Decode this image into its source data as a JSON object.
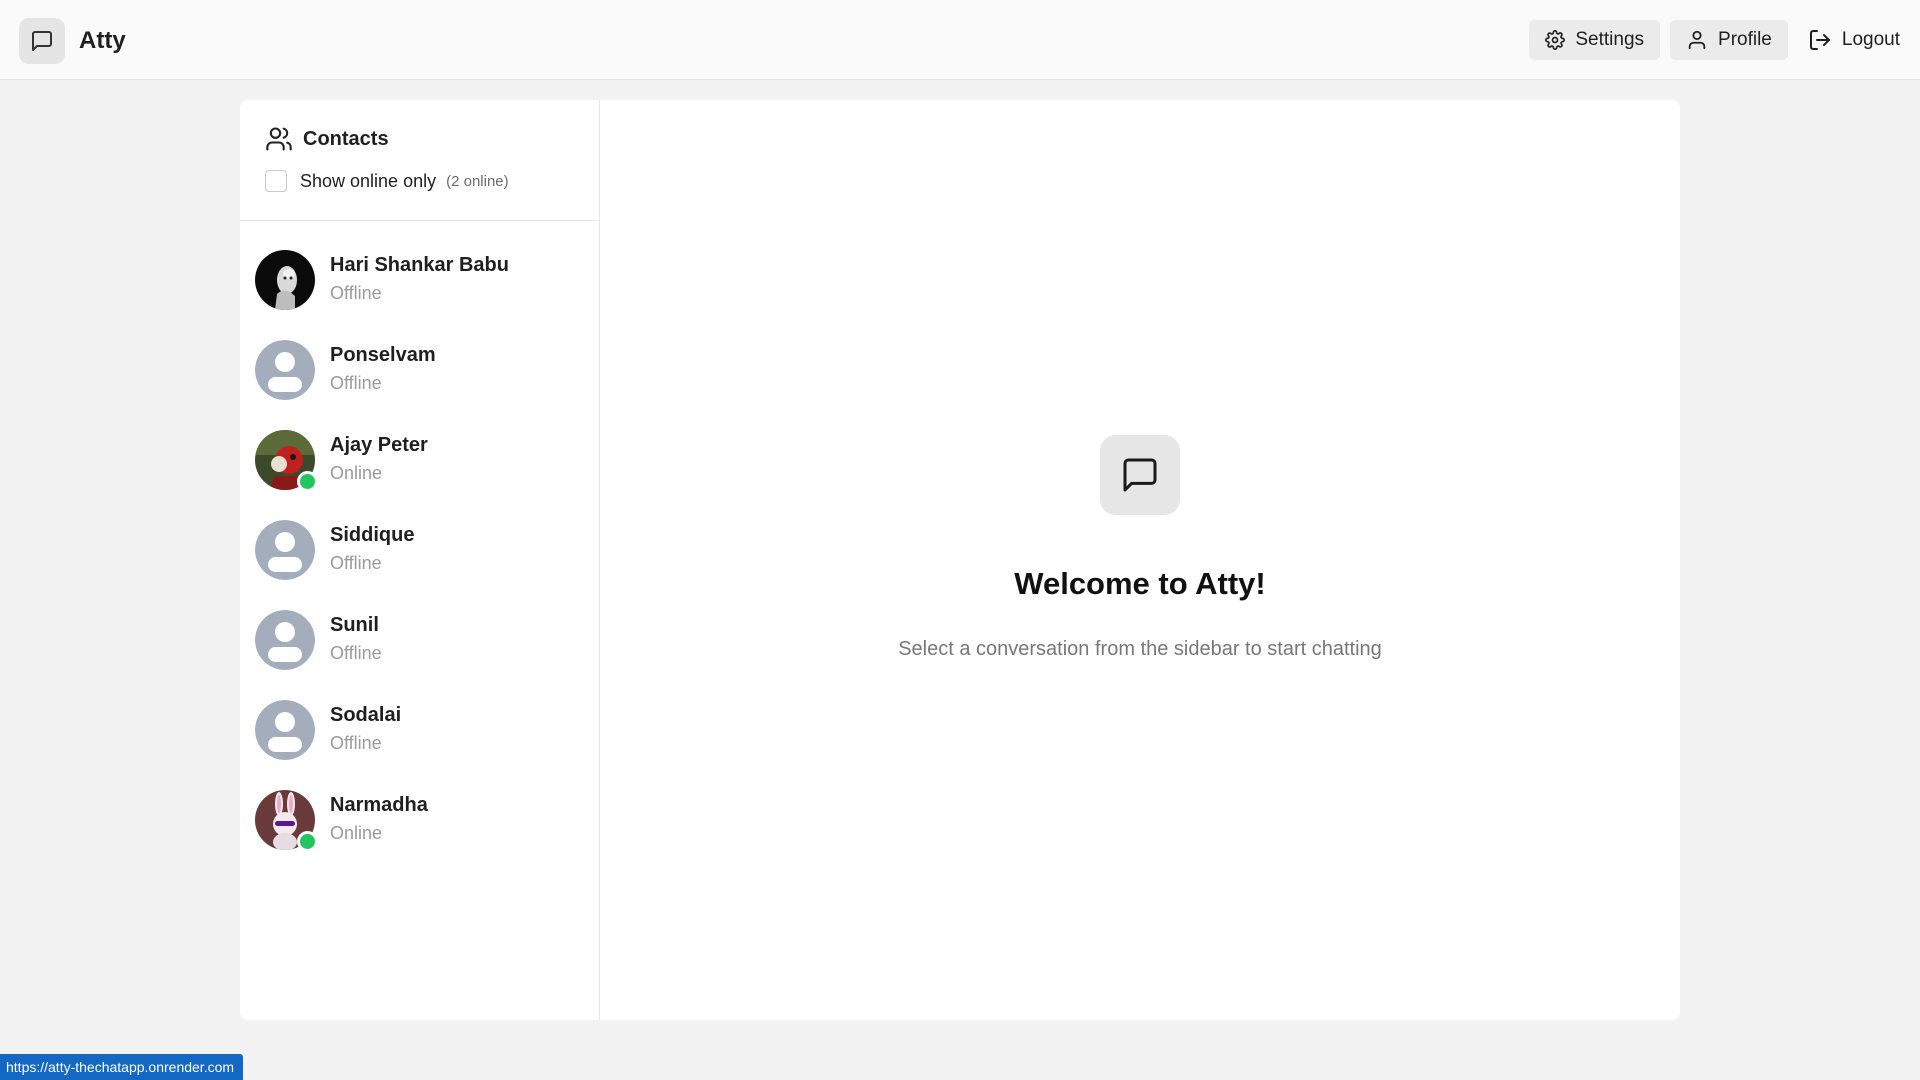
{
  "app": {
    "name": "Atty",
    "icon": "message-square-icon"
  },
  "nav": {
    "settings_label": "Settings",
    "profile_label": "Profile",
    "logout_label": "Logout"
  },
  "sidebar": {
    "title": "Contacts",
    "filter_label": "Show online only",
    "online_count": "(2 online)",
    "contacts": [
      {
        "name": "Hari Shankar Babu",
        "status": "Offline",
        "avatar": "photo",
        "online": false
      },
      {
        "name": "Ponselvam",
        "status": "Offline",
        "avatar": "default",
        "online": false
      },
      {
        "name": "Ajay Peter",
        "status": "Online",
        "avatar": "photo",
        "online": true
      },
      {
        "name": "Siddique",
        "status": "Offline",
        "avatar": "default",
        "online": false
      },
      {
        "name": "Sunil",
        "status": "Offline",
        "avatar": "default",
        "online": false
      },
      {
        "name": "Sodalai",
        "status": "Offline",
        "avatar": "default",
        "online": false
      },
      {
        "name": "Narmadha",
        "status": "Online",
        "avatar": "photo",
        "online": true
      }
    ]
  },
  "welcome": {
    "title": "Welcome to Atty!",
    "subtitle": "Select a conversation from the sidebar to start chatting"
  },
  "status_bar": {
    "url": "https://atty-thechatapp.onrender.com"
  },
  "colors": {
    "online_dot": "#22c55e",
    "url_bar": "#1368c4"
  }
}
